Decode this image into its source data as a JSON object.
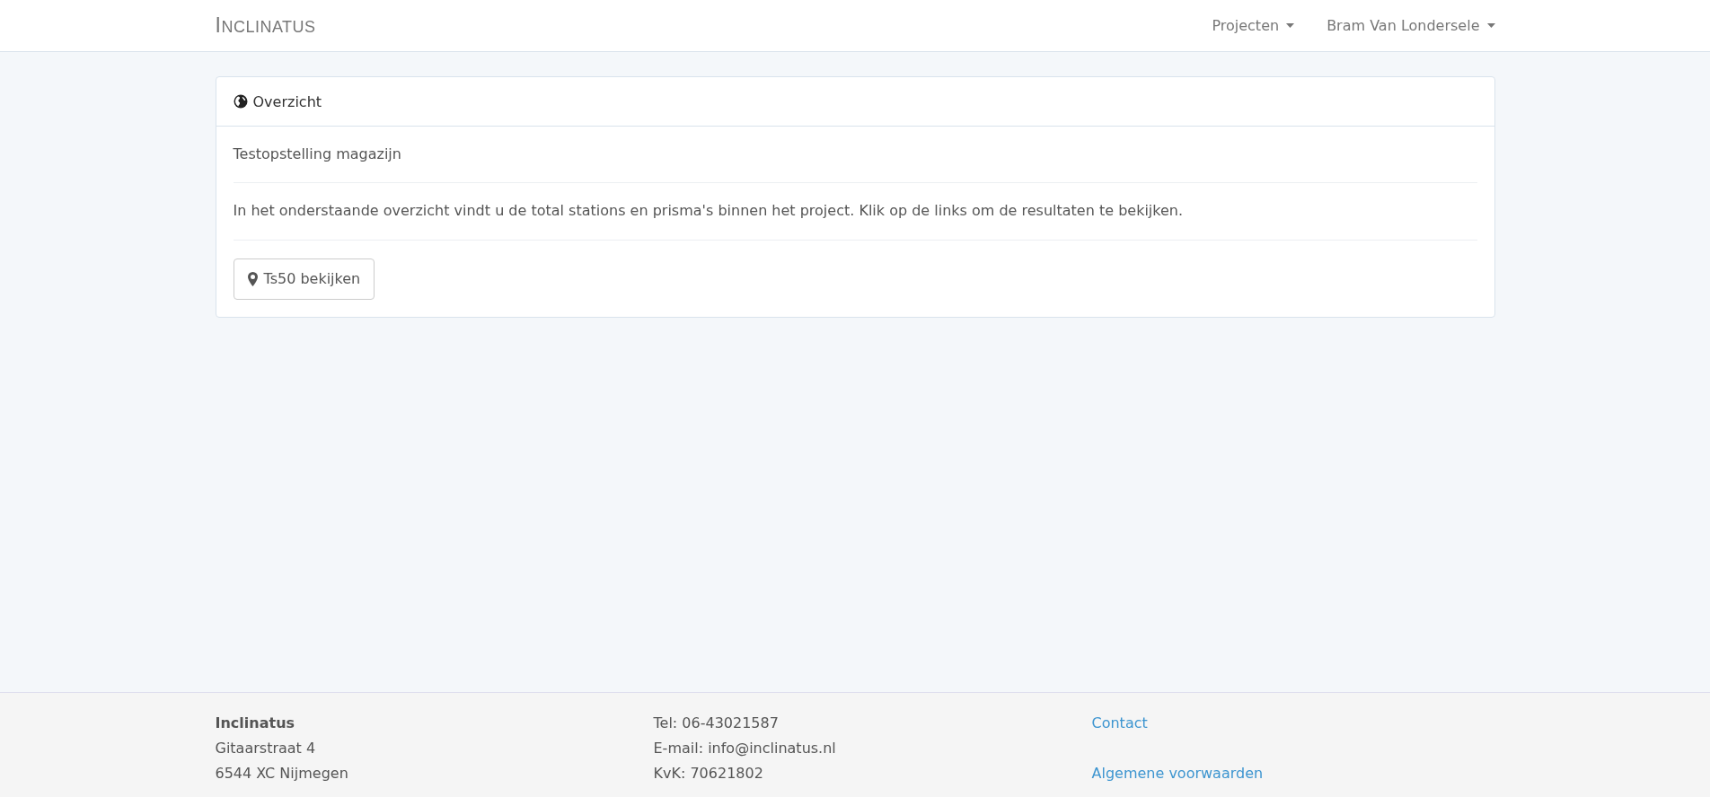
{
  "navbar": {
    "brand": "INCLINATUS",
    "menus": [
      {
        "label": "Projecten"
      },
      {
        "label": "Bram Van Londersele"
      }
    ]
  },
  "panel": {
    "title": "Overzicht",
    "project_name": "Testopstelling magazijn",
    "description": "In het onderstaande overzicht vindt u de total stations en prisma's binnen het project. Klik op de links om de resultaten te bekijken.",
    "buttons": [
      {
        "label": "Ts50 bekijken"
      }
    ]
  },
  "footer": {
    "address": {
      "name": "Inclinatus",
      "street": "Gitaarstraat 4",
      "city": "6544 XC Nijmegen"
    },
    "contact_lines": [
      "Tel: 06-43021587",
      "E-mail: info@inclinatus.nl",
      "KvK: 70621802"
    ],
    "links": [
      "Contact",
      "Algemene voorwaarden"
    ]
  }
}
